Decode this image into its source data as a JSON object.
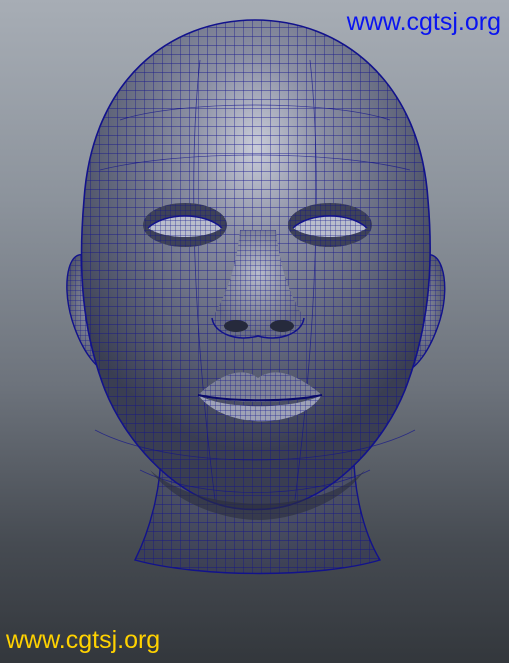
{
  "viewport": {
    "subject": "head-wireframe",
    "colors": {
      "background_top": "#a7adb5",
      "background_bottom": "#33373c",
      "mesh_surface": "#6e7489",
      "wireframe": "#12128c"
    }
  },
  "watermarks": {
    "top_text": "www.cgtsj.org",
    "top_color": "#0a14f0",
    "bottom_text": "www.cgtsj.org",
    "bottom_color": "#ffd200"
  }
}
